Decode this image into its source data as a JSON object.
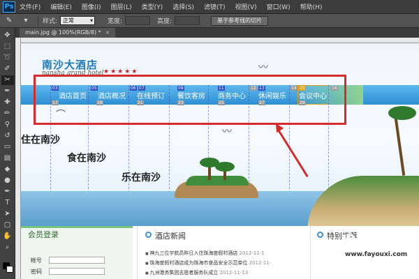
{
  "app": {
    "logo": "Ps"
  },
  "menu": [
    "文件(F)",
    "编辑(E)",
    "图像(I)",
    "图层(L)",
    "类型(Y)",
    "选择(S)",
    "滤镜(T)",
    "视图(V)",
    "窗口(W)",
    "帮助(H)"
  ],
  "options": {
    "style_label": "样式:",
    "style_value": "正常",
    "width_label": "宽度:",
    "height_label": "高度:",
    "guides_button": "基于参考线的切片"
  },
  "document": {
    "tab_label": "main.jpg @ 100%(RGB/8) *",
    "close": "×"
  },
  "site": {
    "title": "南沙大酒店",
    "subtitle": "nansha grand hotel",
    "stars": "★★★★★",
    "nav": [
      "酒店首页",
      "酒店概况",
      "在线预订",
      "餐饮客房",
      "商务中心",
      "休闲娱乐",
      "会议中心"
    ],
    "slice_numbers_top": [
      "03",
      "05",
      "06",
      "07",
      "09",
      "11",
      "12",
      "13",
      "14",
      "15",
      "16"
    ],
    "slice_numbers_bottom": [
      "17",
      "19",
      "21",
      "23",
      "25",
      "27",
      "29"
    ],
    "slogans": [
      "住在南沙",
      "食在南沙",
      "乐在南沙"
    ],
    "login": {
      "title": "会员登录",
      "account_label": "帐号",
      "password_label": "密码"
    },
    "news": {
      "title": "酒店新闻",
      "items": [
        {
          "text": "神九三位宇航员昨日入住珠海度假村酒店",
          "date": "2012-11-1"
        },
        {
          "text": "珠海度假村酒店成为珠海市食品安全示范单位",
          "date": "2012-11-"
        },
        {
          "text": "九洲港务集团志愿者服务队成立",
          "date": "2012-11-13"
        }
      ]
    },
    "special": {
      "title": "特别推荐"
    }
  },
  "watermark": {
    "main": "发游戏",
    "url": "www.fayouxi.com"
  },
  "colors": {
    "annotation_red": "#d62b2b",
    "nav_blue": "#2d8fd3",
    "ps_blue": "#31a8ff",
    "watermark_orange": "#f26b1d"
  }
}
